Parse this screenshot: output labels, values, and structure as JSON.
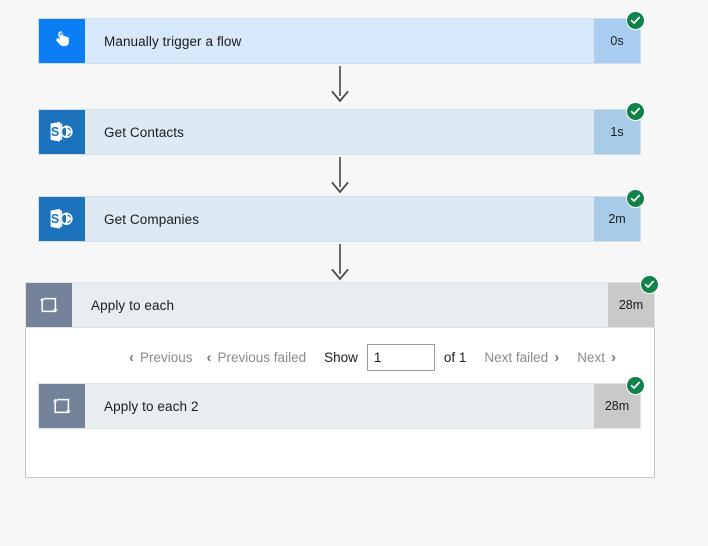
{
  "flow": {
    "background_color": "#f7f7f7",
    "status_color": "#11824a",
    "steps": [
      {
        "name": "manually-trigger-a-flow",
        "title": "Manually trigger a flow",
        "duration": "0s",
        "status": "succeeded",
        "icon": "tap-hand-icon",
        "kind": "trigger",
        "icon_bg": "#0b7ef5",
        "body_bg": "#d6e8fa",
        "duration_bg": "#a8cdf0"
      },
      {
        "name": "get-contacts",
        "title": "Get Contacts",
        "duration": "1s",
        "status": "succeeded",
        "icon": "sharepoint-icon",
        "kind": "sharepoint",
        "icon_bg": "#1c73bc",
        "body_bg": "#dde9f3",
        "duration_bg": "#a8cbe8"
      },
      {
        "name": "get-companies",
        "title": "Get Companies",
        "duration": "2m",
        "status": "succeeded",
        "icon": "sharepoint-icon",
        "kind": "sharepoint",
        "icon_bg": "#1c73bc",
        "body_bg": "#dde9f3",
        "duration_bg": "#a8cbe8"
      },
      {
        "name": "apply-to-each",
        "title": "Apply to each",
        "duration": "28m",
        "status": "succeeded",
        "icon": "loop-icon",
        "kind": "loop",
        "icon_bg": "#74839a",
        "body_bg": "#e8edf1",
        "duration_bg": "#c9c9c9"
      },
      {
        "name": "apply-to-each-2",
        "title": "Apply to each 2",
        "duration": "28m",
        "status": "succeeded",
        "icon": "loop-icon",
        "kind": "loop",
        "icon_bg": "#74839a",
        "body_bg": "#e8edf1",
        "duration_bg": "#c9c9c9"
      }
    ]
  },
  "pagination": {
    "previous_label": "Previous",
    "previous_failed_label": "Previous failed",
    "show_label": "Show",
    "page_value": "1",
    "page_placeholder": "",
    "of_label": "of 1",
    "next_failed_label": "Next failed",
    "next_label": "Next",
    "chevron_left": "‹",
    "chevron_right": "›"
  }
}
